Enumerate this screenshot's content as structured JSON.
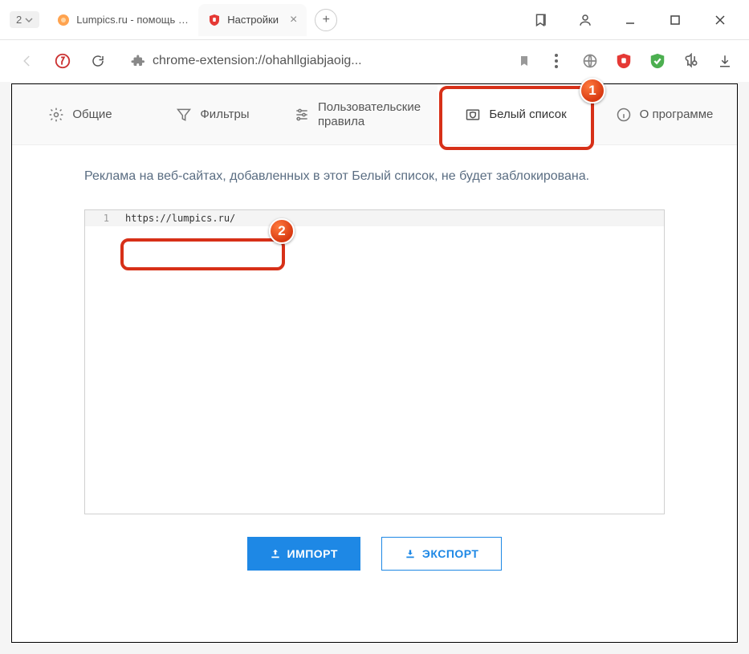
{
  "browser": {
    "tab_group_count": "2",
    "tabs": [
      {
        "title": "Lumpics.ru - помощь с ком"
      },
      {
        "title": "Настройки"
      }
    ],
    "url_display": "chrome-extension://ohahllgiabjaoig..."
  },
  "nav": {
    "general": "Общие",
    "filters": "Фильтры",
    "user_rules": "Пользовательские правила",
    "whitelist": "Белый список",
    "about": "О программе"
  },
  "page": {
    "description": "Реклама на веб-сайтах, добавленных в этот Белый список, не будет заблокирована.",
    "editor_lines": [
      {
        "num": "1",
        "text": "https://lumpics.ru/"
      }
    ],
    "import_label": "ИМПОРТ",
    "export_label": "ЭКСПОРТ"
  },
  "callouts": {
    "one": "1",
    "two": "2"
  }
}
